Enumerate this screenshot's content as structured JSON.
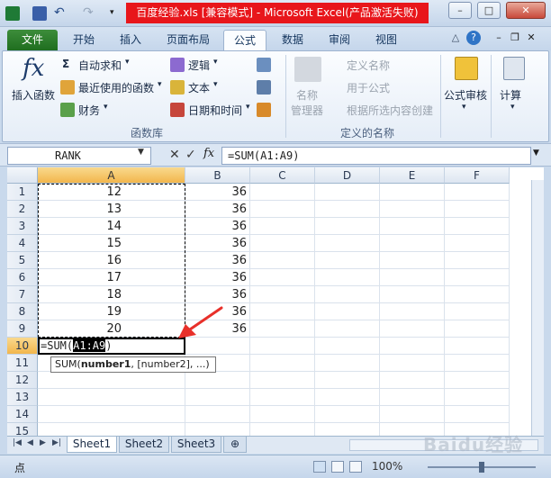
{
  "window": {
    "title": "百度经验.xls  [兼容模式]  -  Microsoft Excel(产品激活失败)",
    "minimize": "–",
    "maximize": "□",
    "close": "✕",
    "title_color": "#e8161b"
  },
  "tabs": [
    {
      "label": "文件"
    },
    {
      "label": "开始"
    },
    {
      "label": "插入"
    },
    {
      "label": "页面布局"
    },
    {
      "label": "公式"
    },
    {
      "label": "数据"
    },
    {
      "label": "审阅"
    },
    {
      "label": "视图"
    }
  ],
  "active_tab": "公式",
  "ribbon": {
    "insert_function": "插入函数",
    "autosum": "自动求和",
    "recent": "最近使用的函数",
    "finance": "财务",
    "logic": "逻辑",
    "text": "文本",
    "datetime": "日期和时间",
    "library_label": "函数库",
    "name_manager_line1": "名称",
    "name_manager_line2": "管理器",
    "define_name": "定义名称",
    "use_in_formula": "用于公式",
    "create_from_selection": "根据所选内容创建",
    "defined_names_label": "定义的名称",
    "formula_audit": "公式审核",
    "calculation": "计算"
  },
  "formula_bar": {
    "name_box": "RANK",
    "cancel": "✕",
    "enter": "✓",
    "fx": "fx",
    "formula": "=SUM(A1:A9)"
  },
  "columns": [
    "A",
    "B",
    "C",
    "D",
    "E",
    "F"
  ],
  "rows": [
    "1",
    "2",
    "3",
    "4",
    "5",
    "6",
    "7",
    "8",
    "9",
    "10",
    "11",
    "12",
    "13",
    "14",
    "15"
  ],
  "col_a_values": [
    "12",
    "13",
    "14",
    "15",
    "16",
    "17",
    "18",
    "19",
    "20"
  ],
  "col_b_values": [
    "36",
    "36",
    "36",
    "36",
    "36",
    "36",
    "36",
    "36",
    "36"
  ],
  "edit_cell": {
    "prefix": "=SUM(",
    "ref": "A1:A9",
    "suffix": ")"
  },
  "tooltip": {
    "fn": "SUM(",
    "arg1": "number1",
    "rest": ", [number2], ...)"
  },
  "sheets": [
    "Sheet1",
    "Sheet2",
    "Sheet3"
  ],
  "active_sheet": "Sheet1",
  "status": {
    "mode": "点",
    "zoom": "100%"
  },
  "watermark": "Baidu经验"
}
